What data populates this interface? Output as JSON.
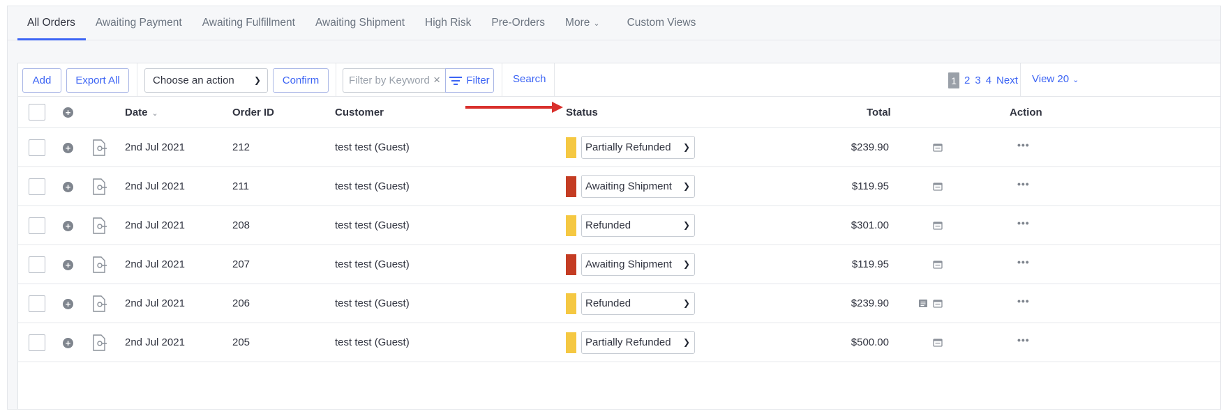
{
  "tabs": [
    {
      "label": "All Orders",
      "active": true
    },
    {
      "label": "Awaiting Payment"
    },
    {
      "label": "Awaiting Fulfillment"
    },
    {
      "label": "Awaiting Shipment"
    },
    {
      "label": "High Risk"
    },
    {
      "label": "Pre-Orders"
    },
    {
      "label": "More"
    },
    {
      "label": "Custom Views"
    }
  ],
  "toolbar": {
    "add_label": "Add",
    "export_label": "Export All",
    "action_select": "Choose an action",
    "confirm_label": "Confirm",
    "keyword_placeholder": "Filter by Keyword",
    "filter_label": "Filter",
    "search_label": "Search",
    "pages": {
      "current": "1",
      "others": [
        "2",
        "3",
        "4"
      ],
      "next": "Next"
    },
    "view_label": "View 20"
  },
  "columns": {
    "date": "Date",
    "order_id": "Order ID",
    "customer": "Customer",
    "status": "Status",
    "total": "Total",
    "action": "Action"
  },
  "colors": {
    "accent": "#3c64f4",
    "yellow": "#f5c842",
    "red": "#c43c23",
    "arrow": "#d9302c"
  },
  "orders": [
    {
      "date": "2nd Jul 2021",
      "id": "212",
      "customer": "test test (Guest)",
      "status": "Partially Refunded",
      "status_color": "yellow",
      "total": "$239.90",
      "extra_icon": false
    },
    {
      "date": "2nd Jul 2021",
      "id": "211",
      "customer": "test test (Guest)",
      "status": "Awaiting Shipment",
      "status_color": "red",
      "total": "$119.95",
      "extra_icon": false
    },
    {
      "date": "2nd Jul 2021",
      "id": "208",
      "customer": "test test (Guest)",
      "status": "Refunded",
      "status_color": "yellow",
      "total": "$301.00",
      "extra_icon": false
    },
    {
      "date": "2nd Jul 2021",
      "id": "207",
      "customer": "test test (Guest)",
      "status": "Awaiting Shipment",
      "status_color": "red",
      "total": "$119.95",
      "extra_icon": false
    },
    {
      "date": "2nd Jul 2021",
      "id": "206",
      "customer": "test test (Guest)",
      "status": "Refunded",
      "status_color": "yellow",
      "total": "$239.90",
      "extra_icon": true
    },
    {
      "date": "2nd Jul 2021",
      "id": "205",
      "customer": "test test (Guest)",
      "status": "Partially Refunded",
      "status_color": "yellow",
      "total": "$500.00",
      "extra_icon": false
    }
  ]
}
